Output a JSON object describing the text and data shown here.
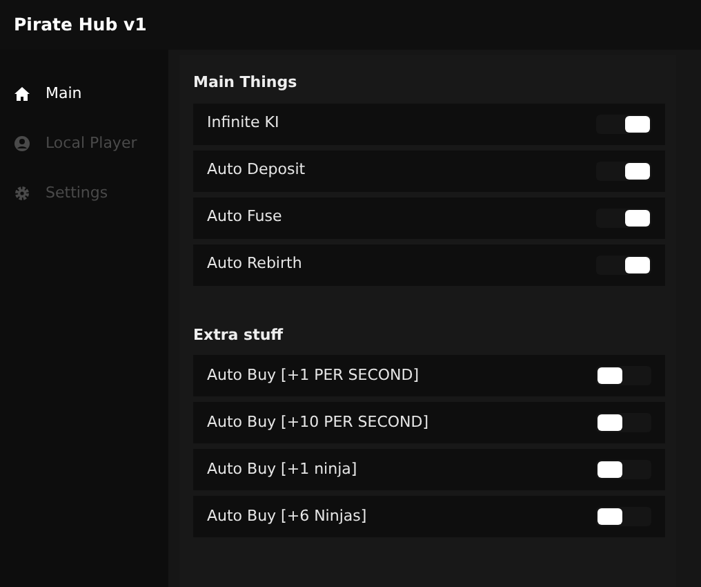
{
  "window": {
    "title": "Pirate Hub v1"
  },
  "sidebar": {
    "items": [
      {
        "label": "Main",
        "kind": "home",
        "selected": true
      },
      {
        "label": "Local Player",
        "kind": "user",
        "selected": false
      },
      {
        "label": "Settings",
        "kind": "gear",
        "selected": false
      }
    ]
  },
  "sections": [
    {
      "title": "Main Things",
      "toggles": [
        {
          "label": "Infinite KI",
          "on": true
        },
        {
          "label": "Auto Deposit",
          "on": true
        },
        {
          "label": "Auto Fuse",
          "on": true
        },
        {
          "label": "Auto Rebirth",
          "on": true
        }
      ]
    },
    {
      "title": "Extra stuff",
      "toggles": [
        {
          "label": "Auto Buy [+1 PER SECOND]",
          "on": false
        },
        {
          "label": "Auto Buy [+10 PER SECOND]",
          "on": false
        },
        {
          "label": "Auto Buy [+1 ninja]",
          "on": false
        },
        {
          "label": "Auto Buy [+6 Ninjas]",
          "on": false
        }
      ]
    }
  ]
}
